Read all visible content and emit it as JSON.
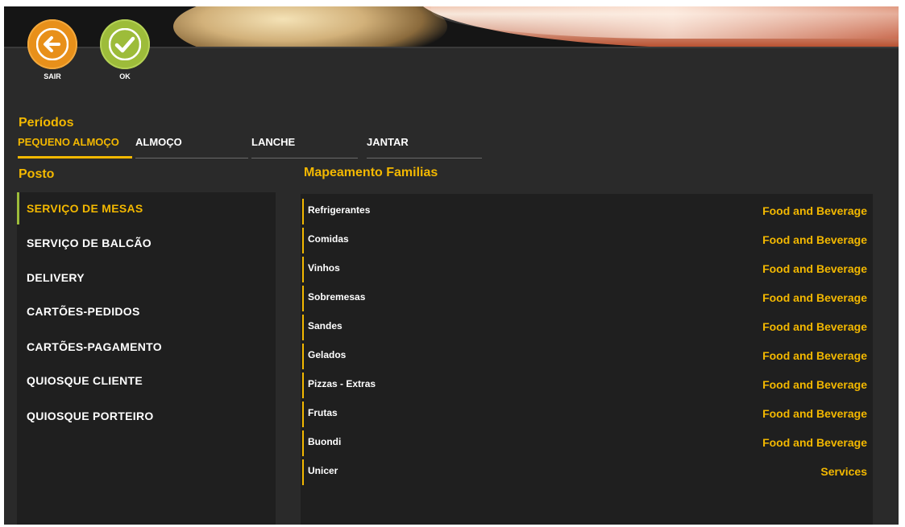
{
  "toolbar": {
    "sair_label": "SAIR",
    "ok_label": "OK",
    "sair_icon": "arrow-left-icon",
    "ok_icon": "check-icon"
  },
  "periodos": {
    "title": "Períodos",
    "tabs": [
      {
        "label": "PEQUENO ALMOÇO",
        "active": true
      },
      {
        "label": "ALMOÇO",
        "active": false
      },
      {
        "label": "LANCHE",
        "active": false
      },
      {
        "label": "JANTAR",
        "active": false
      }
    ]
  },
  "posto": {
    "title": "Posto",
    "items": [
      {
        "label": "SERVIÇO DE MESAS",
        "selected": true
      },
      {
        "label": "SERVIÇO DE BALCÃO",
        "selected": false
      },
      {
        "label": "DELIVERY",
        "selected": false
      },
      {
        "label": "CARTÕES-PEDIDOS",
        "selected": false
      },
      {
        "label": "CARTÕES-PAGAMENTO",
        "selected": false
      },
      {
        "label": "QUIOSQUE CLIENTE",
        "selected": false
      },
      {
        "label": "QUIOSQUE PORTEIRO",
        "selected": false
      }
    ]
  },
  "mapeamento": {
    "title": "Mapeamento Familias",
    "rows": [
      {
        "family": "Refrigerantes",
        "mapping": "Food and Beverage"
      },
      {
        "family": "Comidas",
        "mapping": "Food and Beverage"
      },
      {
        "family": "Vinhos",
        "mapping": "Food and Beverage"
      },
      {
        "family": "Sobremesas",
        "mapping": "Food and Beverage"
      },
      {
        "family": "Sandes",
        "mapping": "Food and Beverage"
      },
      {
        "family": "Gelados",
        "mapping": "Food and Beverage"
      },
      {
        "family": "Pizzas - Extras",
        "mapping": "Food and Beverage"
      },
      {
        "family": "Frutas",
        "mapping": "Food and Beverage"
      },
      {
        "family": "Buondi",
        "mapping": "Food and Beverage"
      },
      {
        "family": "Unicer",
        "mapping": "Services"
      }
    ]
  },
  "colors": {
    "accent": "#f3b800",
    "sair": "#e8901a",
    "ok": "#9dbc3a",
    "panel": "#1f1f1f",
    "background": "#2a2a2a"
  }
}
